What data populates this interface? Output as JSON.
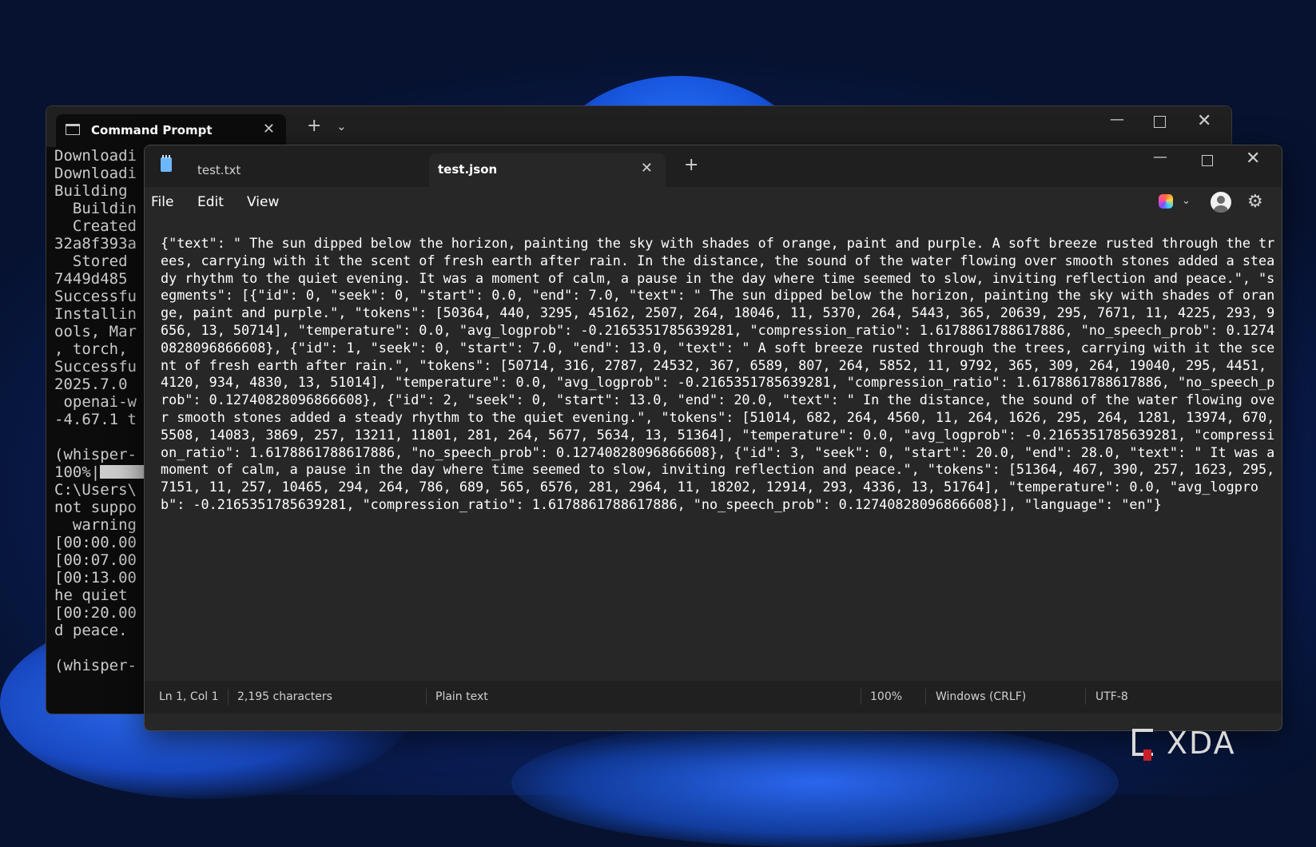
{
  "cmd": {
    "tab_title": "Command Prompt",
    "close_glyph": "✕",
    "newtab_glyph": "+",
    "dropdown_glyph": "⌄",
    "min_glyph": "—",
    "close_window_glyph": "✕",
    "output_before_progress": "Downloadi\nDownloadi\nBuilding \n  Buildin\n  Created\n32a8f393a\n  Stored \n7449d485 \nSuccessfu\nInstallin\nools, Mar\n, torch, \nSuccessfu\n2025.7.0 \n openai-w\n-4.67.1 t\n\n(whisper-\n100%|",
    "output_after_progress": "\nC:\\Users\\\nnot suppo\n  warning\n[00:00.00\n[00:07.00\n[00:13.00\nhe quiet \n[00:20.00\nd peace.\n\n(whisper-"
  },
  "notepad": {
    "tabs": [
      {
        "label": "test.txt"
      },
      {
        "label": "test.json"
      }
    ],
    "close_glyph": "✕",
    "newtab_glyph": "+",
    "min_glyph": "—",
    "close_window_glyph": "✕",
    "menu": [
      "File",
      "Edit",
      "View"
    ],
    "chevron_glyph": "⌄",
    "gear_glyph": "⚙",
    "content": "{\"text\": \" The sun dipped below the horizon, painting the sky with shades of orange, paint and purple. A soft breeze rusted through the trees, carrying with it the scent of fresh earth after rain. In the distance, the sound of the water flowing over smooth stones added a steady rhythm to the quiet evening. It was a moment of calm, a pause in the day where time seemed to slow, inviting reflection and peace.\", \"segments\": [{\"id\": 0, \"seek\": 0, \"start\": 0.0, \"end\": 7.0, \"text\": \" The sun dipped below the horizon, painting the sky with shades of orange, paint and purple.\", \"tokens\": [50364, 440, 3295, 45162, 2507, 264, 18046, 11, 5370, 264, 5443, 365, 20639, 295, 7671, 11, 4225, 293, 9656, 13, 50714], \"temperature\": 0.0, \"avg_logprob\": -0.2165351785639281, \"compression_ratio\": 1.6178861788617886, \"no_speech_prob\": 0.12740828096866608}, {\"id\": 1, \"seek\": 0, \"start\": 7.0, \"end\": 13.0, \"text\": \" A soft breeze rusted through the trees, carrying with it the scent of fresh earth after rain.\", \"tokens\": [50714, 316, 2787, 24532, 367, 6589, 807, 264, 5852, 11, 9792, 365, 309, 264, 19040, 295, 4451, 4120, 934, 4830, 13, 51014], \"temperature\": 0.0, \"avg_logprob\": -0.2165351785639281, \"compression_ratio\": 1.6178861788617886, \"no_speech_prob\": 0.12740828096866608}, {\"id\": 2, \"seek\": 0, \"start\": 13.0, \"end\": 20.0, \"text\": \" In the distance, the sound of the water flowing over smooth stones added a steady rhythm to the quiet evening.\", \"tokens\": [51014, 682, 264, 4560, 11, 264, 1626, 295, 264, 1281, 13974, 670, 5508, 14083, 3869, 257, 13211, 11801, 281, 264, 5677, 5634, 13, 51364], \"temperature\": 0.0, \"avg_logprob\": -0.2165351785639281, \"compression_ratio\": 1.6178861788617886, \"no_speech_prob\": 0.12740828096866608}, {\"id\": 3, \"seek\": 0, \"start\": 20.0, \"end\": 28.0, \"text\": \" It was a moment of calm, a pause in the day where time seemed to slow, inviting reflection and peace.\", \"tokens\": [51364, 467, 390, 257, 1623, 295, 7151, 11, 257, 10465, 294, 264, 786, 689, 565, 6576, 281, 2964, 11, 18202, 12914, 293, 4336, 13, 51764], \"temperature\": 0.0, \"avg_logprob\": -0.2165351785639281, \"compression_ratio\": 1.6178861788617886, \"no_speech_prob\": 0.12740828096866608}], \"language\": \"en\"}",
    "status": {
      "position": "Ln 1, Col 1",
      "characters": "2,195 characters",
      "format": "Plain text",
      "zoom": "100%",
      "line_ending": "Windows (CRLF)",
      "encoding": "UTF-8"
    }
  },
  "watermark": {
    "text": "XDA",
    "accent": "#c8202a"
  }
}
